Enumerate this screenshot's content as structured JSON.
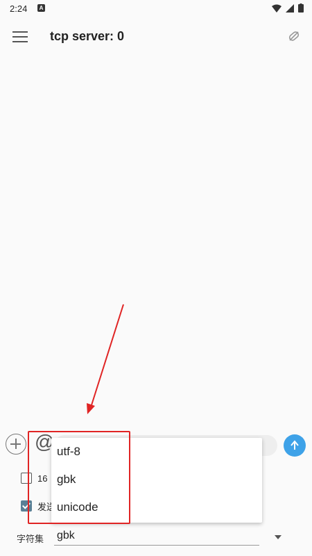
{
  "status_bar": {
    "time": "2:24",
    "notif_letter": "A"
  },
  "app_bar": {
    "title": "tcp server: 0",
    "menu_icon": "hamburger-menu-icon",
    "link_icon": "link-off-icon"
  },
  "input_row": {
    "at_symbol": "@"
  },
  "options": {
    "hex_label_partial": "16",
    "send_label_partial": "发送"
  },
  "charset": {
    "label": "字符集",
    "selected": "gbk"
  },
  "dropdown": {
    "items": [
      "utf-8",
      "gbk",
      "unicode"
    ]
  },
  "colors": {
    "send_button": "#3ea2e8",
    "highlight": "#e02424",
    "checkbox_checked": "#5a7f95"
  }
}
